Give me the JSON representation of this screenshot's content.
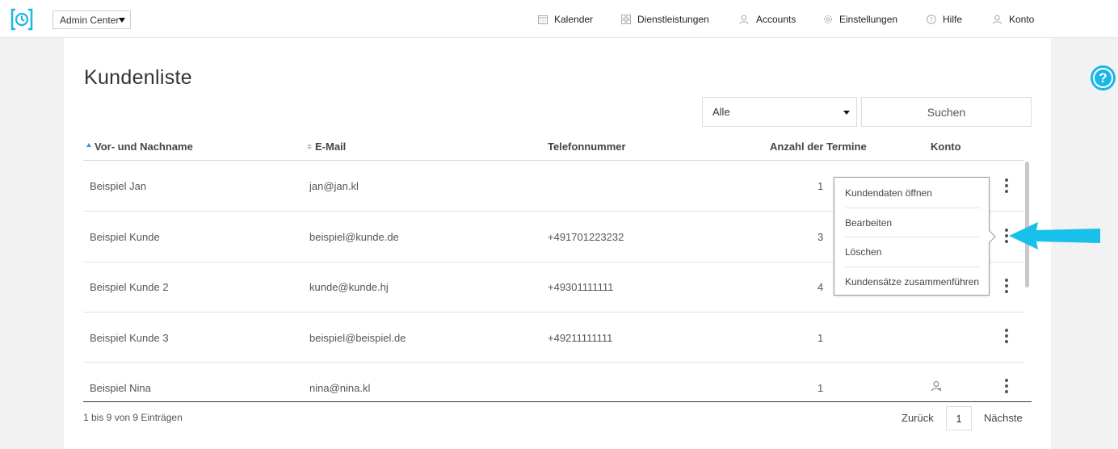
{
  "topbar": {
    "admin_select": "Admin Center",
    "nav": [
      {
        "label": "Kalender",
        "icon": "calendar-icon"
      },
      {
        "label": "Dienstleistungen",
        "icon": "grid-icon"
      },
      {
        "label": "Accounts",
        "icon": "users-icon"
      },
      {
        "label": "Einstellungen",
        "icon": "gear-icon"
      },
      {
        "label": "Hilfe",
        "icon": "question-icon"
      },
      {
        "label": "Konto",
        "icon": "user-icon"
      }
    ]
  },
  "page": {
    "title": "Kundenliste",
    "filter_value": "Alle",
    "search_label": "Suchen"
  },
  "table": {
    "columns": [
      "Vor- und Nachname",
      "E-Mail",
      "Telefonnummer",
      "Anzahl der Termine",
      "Konto"
    ],
    "rows": [
      {
        "name": "Beispiel Jan",
        "email": "jan@jan.kl",
        "phone": "",
        "count": "1",
        "account": false
      },
      {
        "name": "Beispiel Kunde",
        "email": "beispiel@kunde.de",
        "phone": "+491701223232",
        "count": "3",
        "account": false
      },
      {
        "name": "Beispiel Kunde 2",
        "email": "kunde@kunde.hj",
        "phone": "+49301111111",
        "count": "4",
        "account": false
      },
      {
        "name": "Beispiel Kunde 3",
        "email": "beispiel@beispiel.de",
        "phone": "+49211111111",
        "count": "1",
        "account": false
      },
      {
        "name": "Beispiel Nina",
        "email": "nina@nina.kl",
        "phone": "",
        "count": "1",
        "account": true
      }
    ]
  },
  "menu": {
    "items": [
      "Kundendaten öffnen",
      "Bearbeiten",
      "Löschen",
      "Kundensätze zusammenführen"
    ]
  },
  "footer": {
    "info": "1 bis 9 von 9 Einträgen",
    "prev": "Zurück",
    "page": "1",
    "next": "Nächste"
  },
  "colors": {
    "accent": "#19b6e6",
    "sort_active": "#3e8fd6"
  }
}
